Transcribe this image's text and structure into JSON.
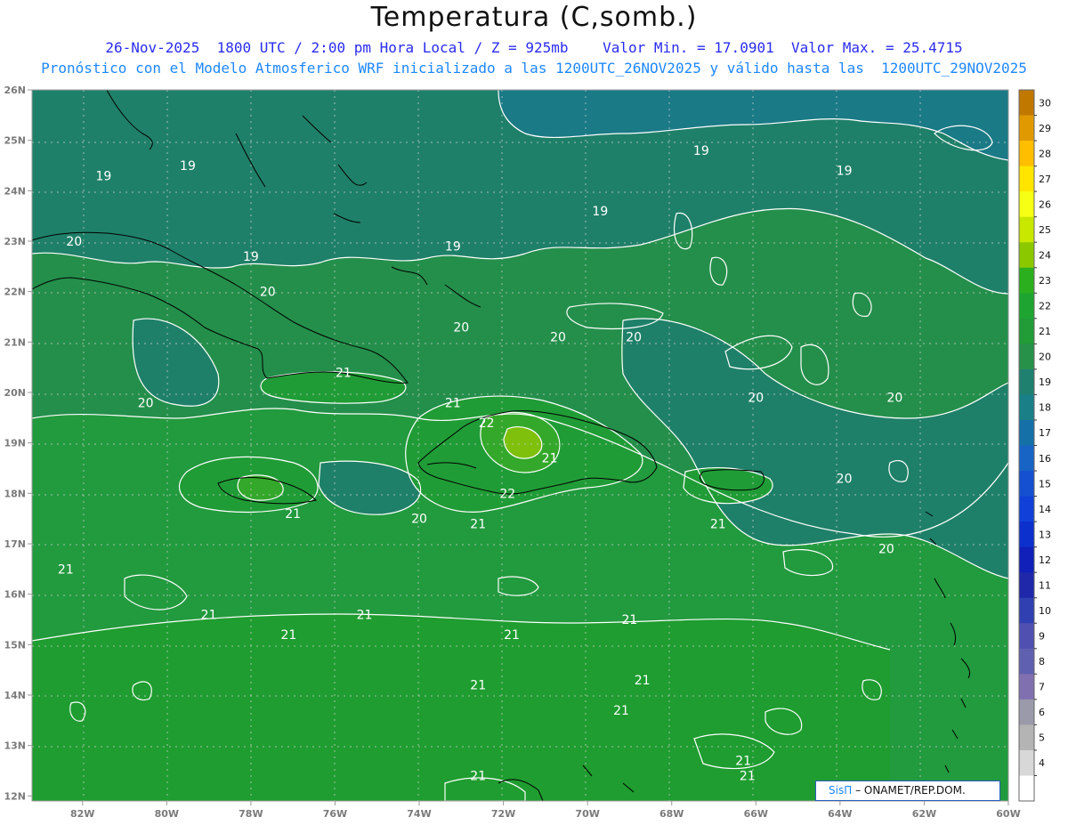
{
  "header": {
    "title": "Temperatura (C,somb.)",
    "line1": "26-Nov-2025  1800 UTC / 2:00 pm Hora Local / Z = 925mb    Valor Min. = 17.0901  Valor Max. = 25.4715",
    "line2": "Pronóstico con el Modelo Atmosferico WRF inicializado a las 1200UTC_26NOV2025 y válido hasta las  1200UTC_29NOV2025"
  },
  "map": {
    "lon_range": [
      -83.2,
      -60.0
    ],
    "lat_range": [
      11.9,
      26.0
    ],
    "lon_ticks": [
      "82W",
      "80W",
      "78W",
      "76W",
      "74W",
      "72W",
      "70W",
      "68W",
      "66W",
      "64W",
      "62W",
      "60W"
    ],
    "lat_ticks": [
      "26N",
      "25N",
      "24N",
      "23N",
      "22N",
      "21N",
      "20N",
      "19N",
      "18N",
      "17N",
      "16N",
      "15N",
      "14N",
      "13N",
      "12N"
    ],
    "contour_labels": [
      {
        "text": "19",
        "lon": -81.5,
        "lat": 24.3
      },
      {
        "text": "19",
        "lon": -79.5,
        "lat": 24.5
      },
      {
        "text": "20",
        "lon": -82.2,
        "lat": 23.0
      },
      {
        "text": "19",
        "lon": -78.0,
        "lat": 22.7
      },
      {
        "text": "20",
        "lon": -77.6,
        "lat": 22.0
      },
      {
        "text": "19",
        "lon": -73.2,
        "lat": 22.9
      },
      {
        "text": "19",
        "lon": -69.7,
        "lat": 23.6
      },
      {
        "text": "19",
        "lon": -67.3,
        "lat": 24.8
      },
      {
        "text": "19",
        "lon": -63.9,
        "lat": 24.4
      },
      {
        "text": "20",
        "lon": -73.0,
        "lat": 21.3
      },
      {
        "text": "20",
        "lon": -70.7,
        "lat": 21.1
      },
      {
        "text": "20",
        "lon": -68.9,
        "lat": 21.1
      },
      {
        "text": "21",
        "lon": -75.8,
        "lat": 20.4
      },
      {
        "text": "20",
        "lon": -80.5,
        "lat": 19.8
      },
      {
        "text": "21",
        "lon": -73.2,
        "lat": 19.8
      },
      {
        "text": "22",
        "lon": -72.4,
        "lat": 19.4
      },
      {
        "text": "21",
        "lon": -70.9,
        "lat": 18.7
      },
      {
        "text": "22",
        "lon": -71.9,
        "lat": 18.0
      },
      {
        "text": "20",
        "lon": -66.0,
        "lat": 19.9
      },
      {
        "text": "20",
        "lon": -62.7,
        "lat": 19.9
      },
      {
        "text": "20",
        "lon": -63.9,
        "lat": 18.3
      },
      {
        "text": "21",
        "lon": -77.0,
        "lat": 17.6
      },
      {
        "text": "20",
        "lon": -74.0,
        "lat": 17.5
      },
      {
        "text": "21",
        "lon": -72.6,
        "lat": 17.4
      },
      {
        "text": "21",
        "lon": -66.9,
        "lat": 17.4
      },
      {
        "text": "20",
        "lon": -62.9,
        "lat": 16.9
      },
      {
        "text": "21",
        "lon": -82.4,
        "lat": 16.5
      },
      {
        "text": "21",
        "lon": -79.0,
        "lat": 15.6
      },
      {
        "text": "21",
        "lon": -75.3,
        "lat": 15.6
      },
      {
        "text": "21",
        "lon": -77.1,
        "lat": 15.2
      },
      {
        "text": "21",
        "lon": -71.8,
        "lat": 15.2
      },
      {
        "text": "21",
        "lon": -69.0,
        "lat": 15.5
      },
      {
        "text": "21",
        "lon": -72.6,
        "lat": 14.2
      },
      {
        "text": "21",
        "lon": -68.7,
        "lat": 14.3
      },
      {
        "text": "21",
        "lon": -69.2,
        "lat": 13.7
      },
      {
        "text": "21",
        "lon": -66.3,
        "lat": 12.7
      },
      {
        "text": "21",
        "lon": -66.2,
        "lat": 12.4
      },
      {
        "text": "21",
        "lon": -72.6,
        "lat": 12.4
      }
    ]
  },
  "colorbar": {
    "values": [
      30,
      29,
      28,
      27,
      26,
      25,
      24,
      23,
      22,
      21,
      20,
      19,
      18,
      17,
      16,
      15,
      14,
      13,
      12,
      11,
      10,
      9,
      8,
      7,
      6,
      5,
      4
    ],
    "labels": [
      "30",
      "29",
      "28",
      "27",
      "26",
      "25",
      "24",
      "23",
      "22",
      "21",
      "20",
      "19",
      "18",
      "17",
      "16",
      "15",
      "14",
      "13",
      "12",
      "11",
      "10",
      "9",
      "8",
      "7",
      "6",
      "5",
      "4"
    ],
    "colors": [
      "#c07800",
      "#e09a00",
      "#ffbe00",
      "#ffe500",
      "#f6ff14",
      "#c8e800",
      "#8cc800",
      "#2caf1e",
      "#1ea531",
      "#229c36",
      "#27914a",
      "#208070",
      "#1a7f86",
      "#1670a8",
      "#1764c4",
      "#1450d0",
      "#1040d8",
      "#0c30cc",
      "#1020b8",
      "#1e28a8",
      "#3040b0",
      "#5050b0",
      "#6060b0",
      "#8070b0",
      "#9a9aaa",
      "#b4b4b4",
      "#d8d8d8",
      "#ffffff"
    ]
  },
  "credit": {
    "logo": "SisΠ",
    "text": "– ONAMET/REP.DOM."
  }
}
